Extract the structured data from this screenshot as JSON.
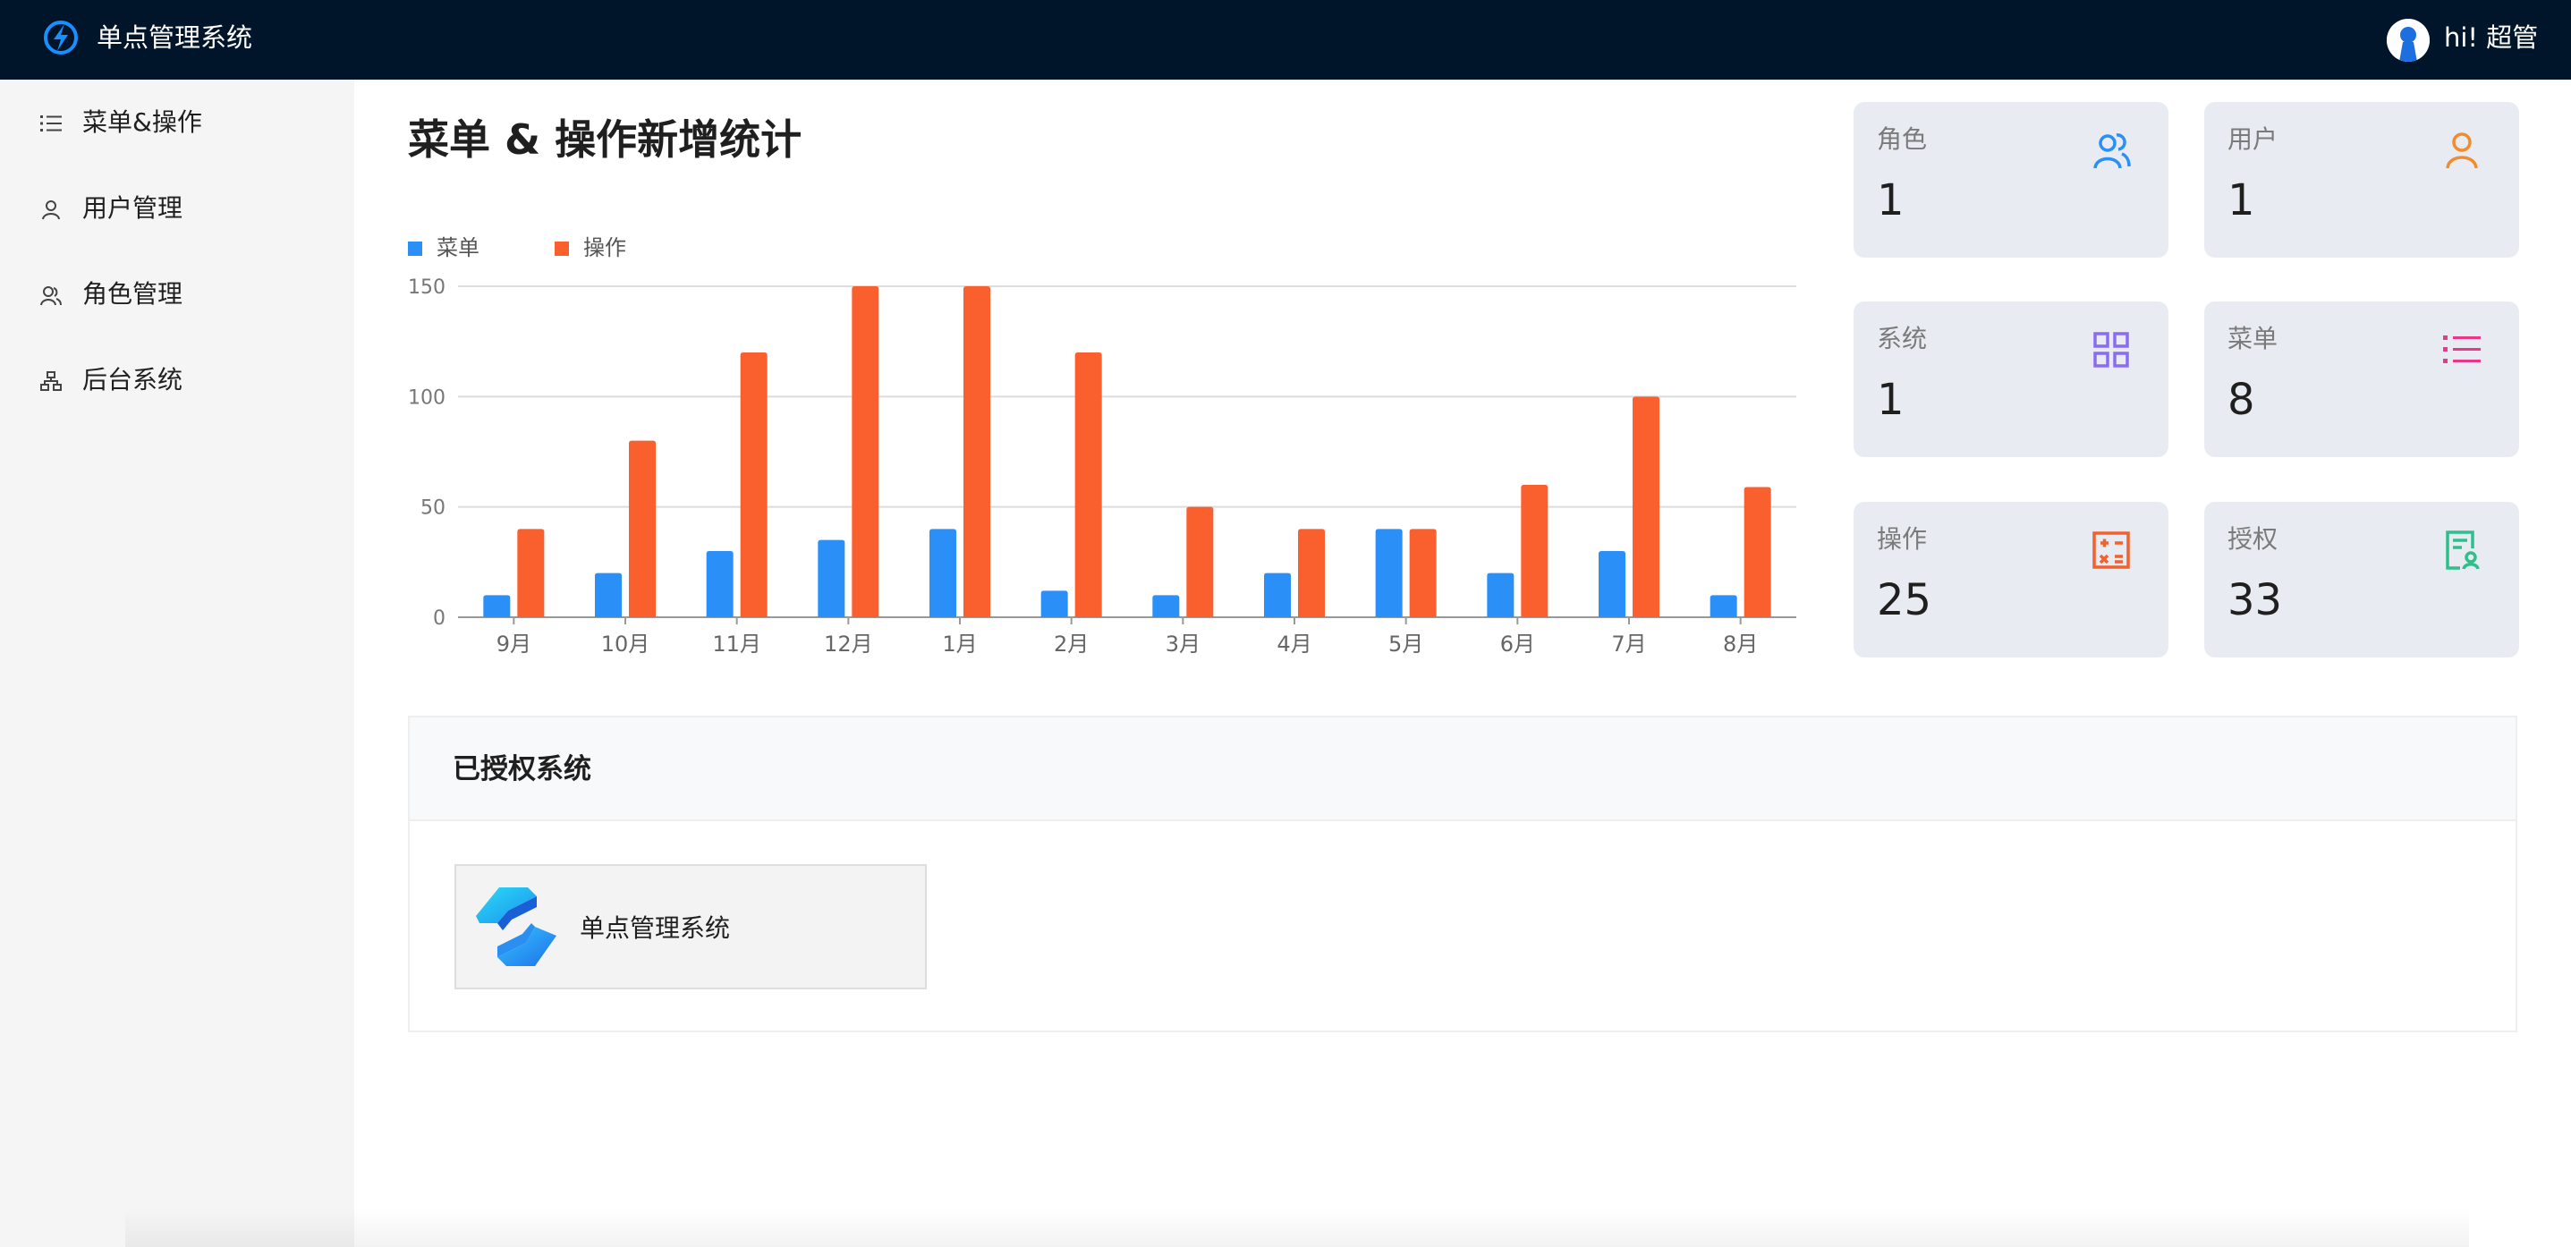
{
  "header": {
    "app_title": "单点管理系统",
    "user_greeting": "hi! 超管",
    "background": "#001529"
  },
  "sidebar": {
    "items": [
      {
        "label": "菜单&操作",
        "icon": "list-icon"
      },
      {
        "label": "用户管理",
        "icon": "user-icon"
      },
      {
        "label": "角色管理",
        "icon": "team-icon"
      },
      {
        "label": "后台系统",
        "icon": "cluster-icon"
      }
    ]
  },
  "main": {
    "title": "菜单 & 操作新增统计"
  },
  "chart_data": {
    "type": "bar",
    "title": "",
    "categories": [
      "9月",
      "10月",
      "11月",
      "12月",
      "1月",
      "2月",
      "3月",
      "4月",
      "5月",
      "6月",
      "7月",
      "8月"
    ],
    "series": [
      {
        "name": "菜单",
        "color": "#2a8ff7",
        "values": [
          10,
          20,
          30,
          35,
          40,
          12,
          10,
          20,
          40,
          20,
          30,
          10
        ]
      },
      {
        "name": "操作",
        "color": "#fa5f2e",
        "values": [
          40,
          80,
          120,
          150,
          150,
          120,
          50,
          40,
          40,
          60,
          100,
          59
        ]
      }
    ],
    "y_ticks": [
      "0",
      "50",
      "100",
      "150"
    ],
    "ylim": [
      0,
      150
    ],
    "grid": true,
    "legend_position": "top-left"
  },
  "stats": [
    {
      "label": "角色",
      "value": "1",
      "icon": "team-icon",
      "color": "#2a8ff7"
    },
    {
      "label": "用户",
      "value": "1",
      "icon": "user-icon",
      "color": "#f08c2e"
    },
    {
      "label": "系统",
      "value": "1",
      "icon": "appstore-icon",
      "color": "#8a6cf0"
    },
    {
      "label": "菜单",
      "value": "8",
      "icon": "list-icon",
      "color": "#e8388a"
    },
    {
      "label": "操作",
      "value": "25",
      "icon": "calculator-icon",
      "color": "#f0622e"
    },
    {
      "label": "授权",
      "value": "33",
      "icon": "audit-icon",
      "color": "#2fbf8a"
    }
  ],
  "authorized": {
    "title": "已授权系统",
    "systems": [
      {
        "name": "单点管理系统",
        "icon": "system-logo-icon"
      }
    ]
  }
}
